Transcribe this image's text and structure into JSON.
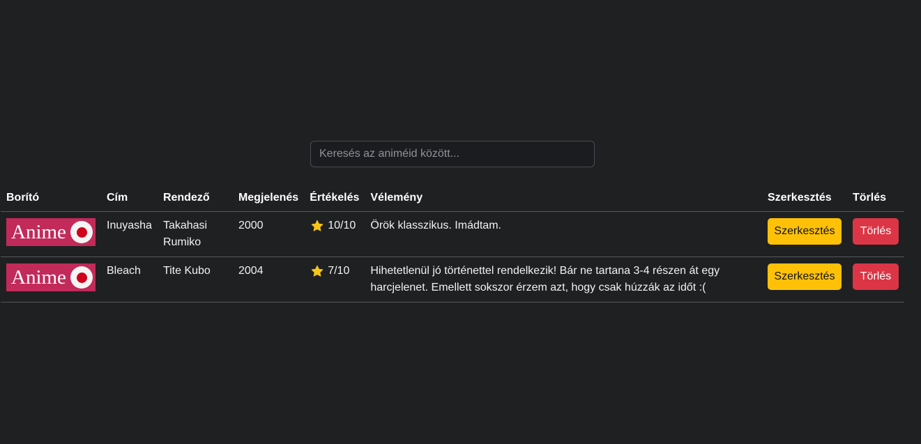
{
  "search": {
    "placeholder": "Keresés az animéid között..."
  },
  "table": {
    "headers": {
      "cover": "Borító",
      "title": "Cím",
      "director": "Rendező",
      "release": "Megjelenés",
      "rating": "Értékelés",
      "review": "Vélemény",
      "edit": "Szerkesztés",
      "delete": "Törlés"
    },
    "rows": [
      {
        "cover_text": "Anime",
        "title": "Inuyasha",
        "director": "Takahasi Rumiko",
        "release": "2000",
        "rating": "10/10",
        "review": "Örök klasszikus. Imádtam.",
        "edit_label": "Szerkesztés",
        "delete_label": "Törlés"
      },
      {
        "cover_text": "Anime",
        "title": "Bleach",
        "director": "Tite Kubo",
        "release": "2004",
        "rating": "7/10",
        "review": "Hihetetlenül jó történettel rendelkezik! Bár ne tartana 3-4 részen át egy harcjelenet. Emellett sokszor érzem azt, hogy csak húzzák az időt :(",
        "edit_label": "Szerkesztés",
        "delete_label": "Törlés"
      }
    ]
  },
  "colors": {
    "background": "#1f2022",
    "edit_button": "#ffc107",
    "delete_button": "#dc3545",
    "cover": "#c22a5a",
    "star": "#f5c518"
  },
  "icons": {
    "rating": "star-icon"
  }
}
